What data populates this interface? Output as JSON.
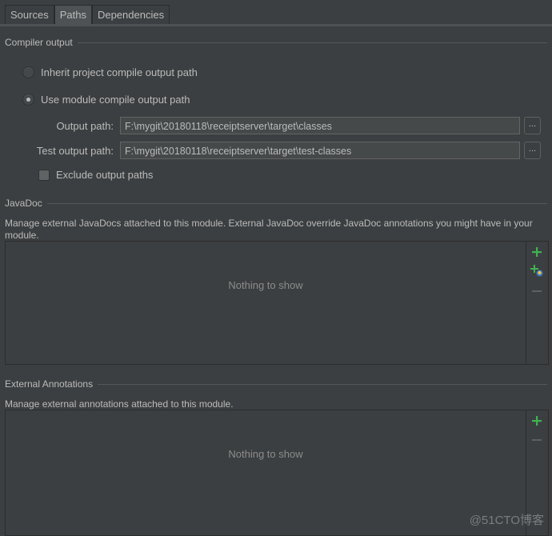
{
  "tabs": [
    {
      "label": "Sources",
      "active": false
    },
    {
      "label": "Paths",
      "active": true
    },
    {
      "label": "Dependencies",
      "active": false
    }
  ],
  "compiler_output": {
    "title": "Compiler output",
    "options": [
      {
        "label": "Inherit project compile output path",
        "selected": false
      },
      {
        "label": "Use module compile output path",
        "selected": true
      }
    ],
    "output_path": {
      "label": "Output path:",
      "value": "F:\\mygit\\20180118\\receiptserver\\target\\classes",
      "browse": "..."
    },
    "test_output_path": {
      "label": "Test output path:",
      "value": "F:\\mygit\\20180118\\receiptserver\\target\\test-classes",
      "browse": "..."
    },
    "exclude": {
      "label": "Exclude output paths",
      "checked": false
    }
  },
  "javadoc": {
    "title": "JavaDoc",
    "description": "Manage external JavaDocs attached to this module. External JavaDoc override JavaDoc annotations you might have in your module.",
    "empty_text": "Nothing to show",
    "toolbar": [
      "add-icon",
      "add-url-icon",
      "remove-icon"
    ]
  },
  "external_annotations": {
    "title": "External Annotations",
    "description": "Manage external annotations attached to this module.",
    "empty_text": "Nothing to show",
    "toolbar": [
      "add-icon",
      "remove-icon"
    ]
  },
  "watermark": "@51CTO博客",
  "colors": {
    "add": "#3fb34f",
    "background": "#3c3f41",
    "text": "#bbbbbb"
  }
}
